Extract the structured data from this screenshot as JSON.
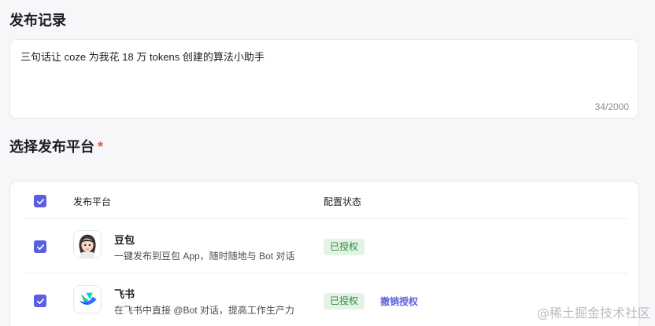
{
  "section_record": {
    "title": "发布记录"
  },
  "record": {
    "text": "三句话让 coze 为我花 18 万 tokens 创建的算法小助手",
    "count": "34/2000"
  },
  "section_platform": {
    "title": "选择发布平台",
    "required_mark": "*"
  },
  "table": {
    "headers": {
      "platform": "发布平台",
      "status": "配置状态"
    },
    "rows": [
      {
        "name": "豆包",
        "description": "一键发布到豆包 App，随时随地与 Bot 对话",
        "status": "已授权",
        "logo_icon": "doubao-avatar-icon"
      },
      {
        "name": "飞书",
        "description": "在飞书中直接 @Bot 对话，提高工作生产力",
        "status": "已授权",
        "action": "撤销授权",
        "logo_icon": "feishu-logo-icon"
      }
    ]
  },
  "watermark": "@稀土掘金技术社区",
  "colors": {
    "accent": "#5a5fe0",
    "badge_bg": "#e3f4e6",
    "badge_text": "#2f8a3c",
    "required": "#f5523a"
  }
}
